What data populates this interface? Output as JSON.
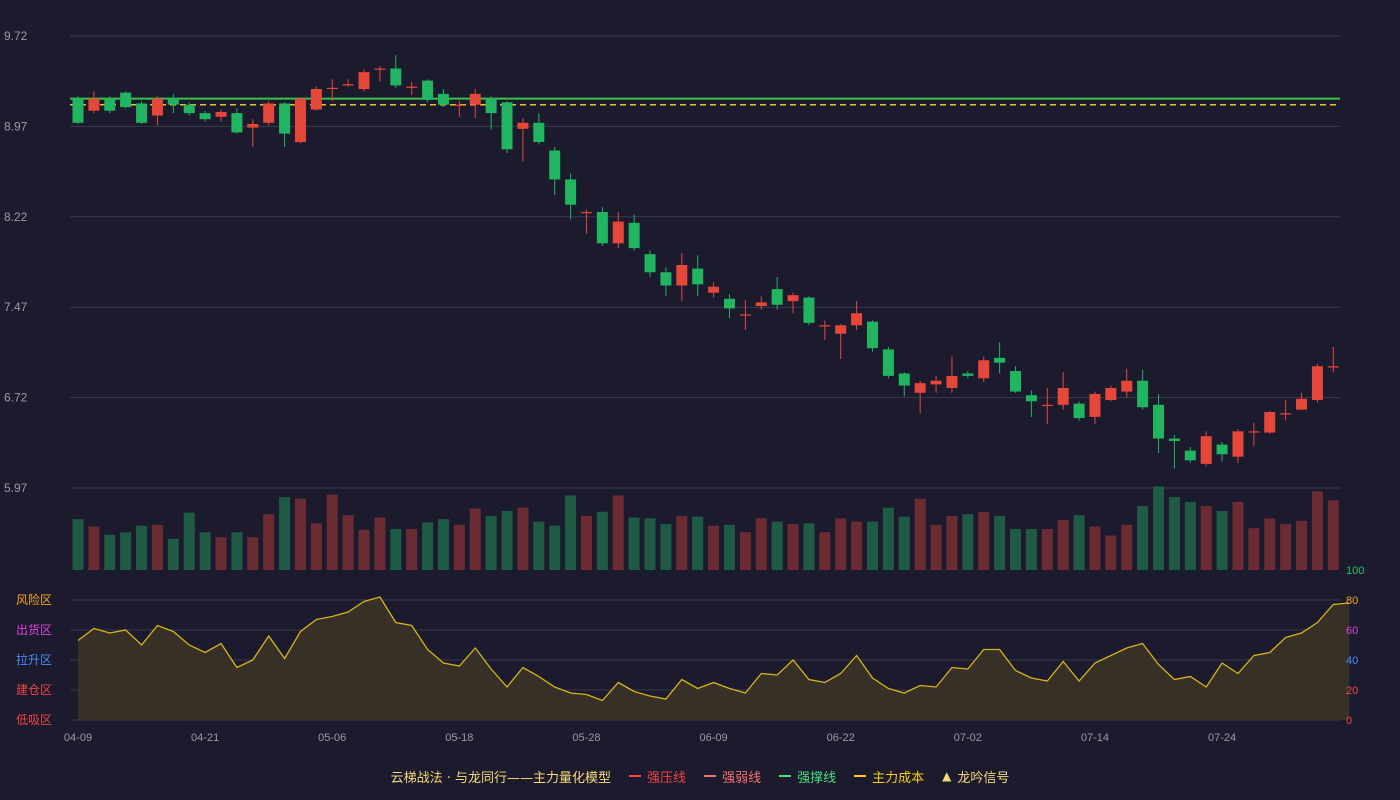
{
  "theme": {
    "background": "#1b1b2d",
    "up_color": "#e5483a",
    "down_color": "#21b461",
    "vol_up_color": "#6a2b33",
    "vol_down_color": "#1f5a45",
    "grid_color": "#3a3a4c",
    "axis_text": "#9a9aa6",
    "support_color": "#3bc14a",
    "cost_color": "#e6c126",
    "indicator_line": "#d6b41e",
    "indicator_fill": "#3a3326"
  },
  "chart_data": [
    {
      "type": "candlestick",
      "panel": "price",
      "y_ticks": [
        "9.72",
        "8.97",
        "8.22",
        "7.47",
        "6.72",
        "5.97"
      ],
      "ylim": [
        5.97,
        9.72
      ],
      "support_line": 9.2,
      "cost_line": 9.15,
      "x_ticks": [
        "04-09",
        "04-21",
        "05-06",
        "05-18",
        "05-28",
        "06-09",
        "06-22",
        "07-02",
        "07-14",
        "07-24"
      ],
      "x_tick_index": [
        0,
        8,
        16,
        24,
        32,
        40,
        48,
        56,
        64,
        72
      ],
      "candles": [
        [
          9.2,
          9.0,
          9.22,
          8.99
        ],
        [
          9.1,
          9.2,
          9.26,
          9.08
        ],
        [
          9.2,
          9.1,
          9.22,
          9.08
        ],
        [
          9.25,
          9.13,
          9.26,
          9.12
        ],
        [
          9.16,
          9.0,
          9.18,
          8.99
        ],
        [
          9.06,
          9.2,
          9.22,
          8.98
        ],
        [
          9.2,
          9.15,
          9.24,
          9.08
        ],
        [
          9.15,
          9.08,
          9.17,
          9.06
        ],
        [
          9.08,
          9.03,
          9.1,
          9.01
        ],
        [
          9.05,
          9.09,
          9.11,
          9.01
        ],
        [
          9.08,
          8.92,
          9.12,
          8.91
        ],
        [
          8.96,
          8.99,
          9.03,
          8.8
        ],
        [
          9.0,
          9.16,
          9.18,
          8.98
        ],
        [
          9.16,
          8.91,
          9.17,
          8.8
        ],
        [
          8.84,
          9.2,
          9.21,
          8.83
        ],
        [
          9.11,
          9.28,
          9.3,
          9.1
        ],
        [
          9.28,
          9.29,
          9.36,
          9.18
        ],
        [
          9.32,
          9.32,
          9.36,
          9.3
        ],
        [
          9.28,
          9.42,
          9.44,
          9.26
        ],
        [
          9.45,
          9.45,
          9.47,
          9.34
        ],
        [
          9.45,
          9.31,
          9.56,
          9.29
        ],
        [
          9.3,
          9.3,
          9.34,
          9.23
        ],
        [
          9.35,
          9.19,
          9.36,
          9.17
        ],
        [
          9.24,
          9.15,
          9.28,
          9.13
        ],
        [
          9.15,
          9.15,
          9.18,
          9.05
        ],
        [
          9.15,
          9.24,
          9.28,
          9.04
        ],
        [
          9.2,
          9.08,
          9.22,
          8.94
        ],
        [
          9.17,
          8.78,
          9.18,
          8.75
        ],
        [
          8.95,
          9.0,
          9.04,
          8.68
        ],
        [
          9.0,
          8.84,
          9.08,
          8.82
        ],
        [
          8.77,
          8.53,
          8.8,
          8.4
        ],
        [
          8.53,
          8.32,
          8.58,
          8.2
        ],
        [
          8.26,
          8.26,
          8.28,
          8.08
        ],
        [
          8.26,
          8.0,
          8.3,
          7.98
        ],
        [
          8.0,
          8.18,
          8.26,
          7.96
        ],
        [
          8.17,
          7.96,
          8.24,
          7.94
        ],
        [
          7.91,
          7.76,
          7.94,
          7.72
        ],
        [
          7.76,
          7.65,
          7.8,
          7.56
        ],
        [
          7.65,
          7.82,
          7.92,
          7.52
        ],
        [
          7.79,
          7.66,
          7.9,
          7.56
        ],
        [
          7.59,
          7.64,
          7.68,
          7.55
        ],
        [
          7.54,
          7.46,
          7.58,
          7.38
        ],
        [
          7.41,
          7.41,
          7.53,
          7.28
        ],
        [
          7.48,
          7.51,
          7.56,
          7.45
        ],
        [
          7.62,
          7.49,
          7.72,
          7.45
        ],
        [
          7.52,
          7.57,
          7.59,
          7.42
        ],
        [
          7.55,
          7.34,
          7.56,
          7.32
        ],
        [
          7.32,
          7.32,
          7.36,
          7.2
        ],
        [
          7.25,
          7.32,
          7.33,
          7.04
        ],
        [
          7.32,
          7.42,
          7.52,
          7.28
        ],
        [
          7.35,
          7.13,
          7.36,
          7.1
        ],
        [
          7.12,
          6.9,
          7.14,
          6.88
        ],
        [
          6.92,
          6.82,
          6.93,
          6.73
        ],
        [
          6.76,
          6.84,
          6.86,
          6.59
        ],
        [
          6.83,
          6.86,
          6.9,
          6.76
        ],
        [
          6.8,
          6.9,
          7.06,
          6.76
        ],
        [
          6.92,
          6.9,
          6.94,
          6.88
        ],
        [
          6.88,
          7.03,
          7.06,
          6.85
        ],
        [
          7.05,
          7.01,
          7.18,
          6.92
        ],
        [
          6.94,
          6.77,
          6.98,
          6.76
        ],
        [
          6.74,
          6.69,
          6.78,
          6.56
        ],
        [
          6.65,
          6.66,
          6.8,
          6.5
        ],
        [
          6.66,
          6.8,
          6.93,
          6.62
        ],
        [
          6.67,
          6.55,
          6.69,
          6.53
        ],
        [
          6.56,
          6.75,
          6.77,
          6.5
        ],
        [
          6.7,
          6.8,
          6.82,
          6.69
        ],
        [
          6.77,
          6.86,
          6.96,
          6.72
        ],
        [
          6.86,
          6.64,
          6.95,
          6.62
        ],
        [
          6.66,
          6.38,
          6.75,
          6.26
        ],
        [
          6.38,
          6.36,
          6.41,
          6.13
        ],
        [
          6.28,
          6.2,
          6.31,
          6.18
        ],
        [
          6.17,
          6.4,
          6.44,
          6.15
        ],
        [
          6.33,
          6.25,
          6.35,
          6.19
        ],
        [
          6.23,
          6.44,
          6.46,
          6.18
        ],
        [
          6.44,
          6.44,
          6.51,
          6.32
        ],
        [
          6.43,
          6.6,
          6.61,
          6.42
        ],
        [
          6.59,
          6.59,
          6.7,
          6.53
        ],
        [
          6.62,
          6.71,
          6.76,
          6.62
        ],
        [
          6.7,
          6.98,
          7.0,
          6.68
        ],
        [
          6.98,
          6.98,
          7.14,
          6.93
        ]
      ]
    },
    {
      "type": "bar",
      "panel": "volume",
      "values": [
        0.62,
        0.53,
        0.43,
        0.46,
        0.54,
        0.55,
        0.38,
        0.7,
        0.46,
        0.4,
        0.46,
        0.4,
        0.68,
        0.89,
        0.87,
        0.57,
        0.92,
        0.67,
        0.49,
        0.64,
        0.5,
        0.5,
        0.58,
        0.62,
        0.55,
        0.75,
        0.66,
        0.72,
        0.76,
        0.59,
        0.54,
        0.91,
        0.66,
        0.71,
        0.91,
        0.64,
        0.63,
        0.56,
        0.66,
        0.65,
        0.54,
        0.55,
        0.46,
        0.63,
        0.59,
        0.56,
        0.57,
        0.46,
        0.63,
        0.59,
        0.59,
        0.76,
        0.65,
        0.87,
        0.55,
        0.66,
        0.68,
        0.71,
        0.66,
        0.5,
        0.5,
        0.5,
        0.61,
        0.67,
        0.53,
        0.42,
        0.55,
        0.78,
        1.02,
        0.89,
        0.83,
        0.78,
        0.72,
        0.83,
        0.51,
        0.63,
        0.56,
        0.6,
        0.96,
        0.85
      ]
    },
    {
      "type": "area",
      "panel": "indicator",
      "ylim": [
        0,
        100
      ],
      "y_ticks": [
        "100",
        "80",
        "60",
        "40",
        "20",
        "0"
      ],
      "tick_colors": [
        "#22c55e",
        "#f5a623",
        "#e040e0",
        "#4b8bff",
        "#ef4444",
        "#ef4444"
      ],
      "zones": [
        {
          "label": "风险区",
          "color": "#f5a623"
        },
        {
          "label": "出货区",
          "color": "#e040e0"
        },
        {
          "label": "拉升区",
          "color": "#4b8bff"
        },
        {
          "label": "建仓区",
          "color": "#ef4444"
        },
        {
          "label": "低吸区",
          "color": "#ef4444"
        }
      ],
      "values": [
        53,
        61,
        58,
        60,
        50,
        63,
        59,
        50,
        45,
        51,
        35,
        40,
        56,
        41,
        59,
        67,
        69,
        72,
        79,
        82,
        65,
        63,
        47,
        38,
        36,
        48,
        34,
        22,
        35,
        29,
        22,
        18,
        17,
        13,
        25,
        19,
        16,
        14,
        27,
        21,
        25,
        21,
        18,
        31,
        30,
        40,
        27,
        25,
        31,
        43,
        28,
        21,
        18,
        23,
        22,
        35,
        34,
        47,
        47,
        33,
        28,
        26,
        39,
        26,
        38,
        43,
        48,
        51,
        37,
        27,
        29,
        22,
        38,
        31,
        43,
        45,
        55,
        58,
        65,
        77,
        78
      ]
    }
  ],
  "legend": {
    "title": "云梯战法 · 与龙同行——主力量化模型",
    "items": [
      {
        "label": "强压线",
        "color": "#ef4444",
        "dashed": false
      },
      {
        "label": "强弱线",
        "color": "#f87171",
        "dashed": true
      },
      {
        "label": "强撑线",
        "color": "#4ade80",
        "dashed": false
      },
      {
        "label": "主力成本",
        "color": "#facc15",
        "dashed": true
      }
    ],
    "signal_label": "龙吟信号",
    "signal_icon": "triangle-up-icon"
  }
}
